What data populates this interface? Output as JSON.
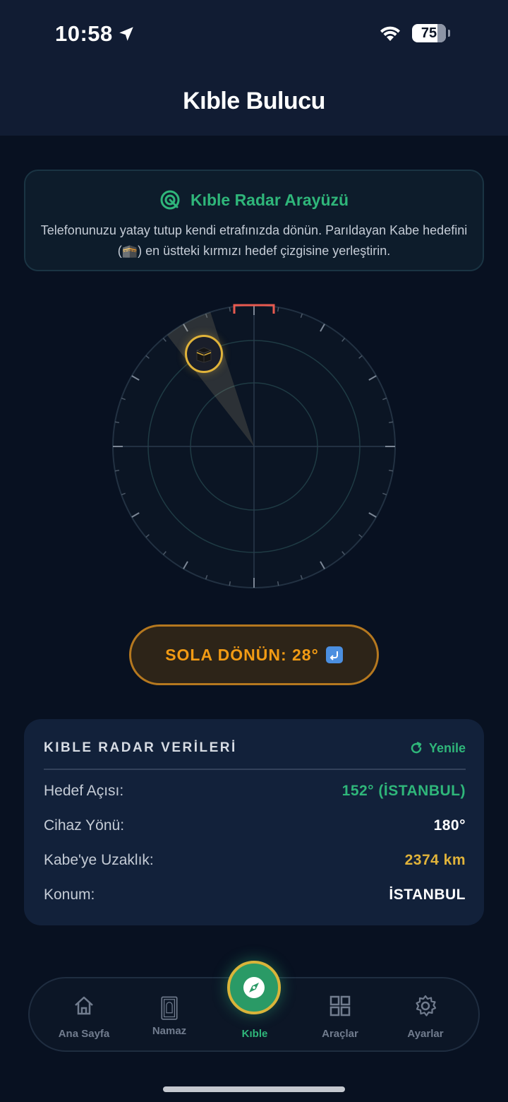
{
  "status_bar": {
    "time": "10:58",
    "battery": "75"
  },
  "header": {
    "title": "Kıble Bulucu"
  },
  "info_card": {
    "title": "Kıble Radar Arayüzü",
    "text": "Telefonunuzu yatay tutup kendi etrafınızda dönün. Parıldayan Kabe hedefini (🕋) en üstteki kırmızı hedef çizgisine yerleştirin."
  },
  "radar": {
    "target_bearing_deg": 152,
    "device_heading_deg": 180,
    "relative_angle_deg": -28,
    "colors": {
      "target_line": "#e85a50",
      "marker_ring": "#e0b33a",
      "grid": "#223142"
    }
  },
  "turn_button": {
    "label": "SOLA DÖNÜN: 28°"
  },
  "data_card": {
    "title": "KIBLE RADAR VERİLERİ",
    "refresh_label": "Yenile",
    "rows": [
      {
        "label": "Hedef Açısı:",
        "value": "152° (İSTANBUL)",
        "color": "#2fb67a"
      },
      {
        "label": "Cihaz Yönü:",
        "value": "180°",
        "color": "#ffffff"
      },
      {
        "label": "Kabe'ye Uzaklık:",
        "value": "2374 km",
        "color": "#e0b33a"
      },
      {
        "label": "Konum:",
        "value": "İSTANBUL",
        "color": "#ffffff"
      }
    ]
  },
  "bottom_nav": {
    "items": [
      {
        "label": "Ana Sayfa",
        "icon": "home-icon"
      },
      {
        "label": "Namaz",
        "icon": "prayer-mat-icon"
      },
      {
        "label": "Kıble",
        "icon": "compass-icon",
        "active": true
      },
      {
        "label": "Araçlar",
        "icon": "grid-icon"
      },
      {
        "label": "Ayarlar",
        "icon": "gear-icon"
      }
    ]
  },
  "accent_color": "#2fb67a"
}
